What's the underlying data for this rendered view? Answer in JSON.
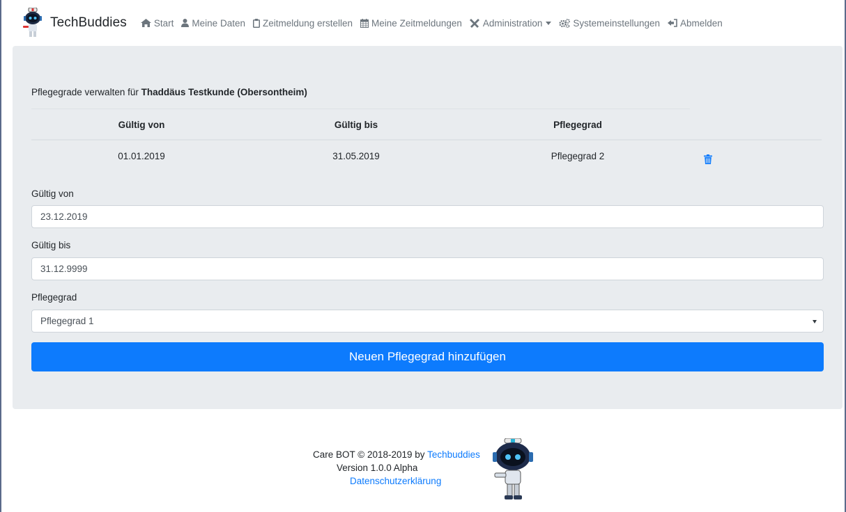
{
  "brand": {
    "name": "TechBuddies"
  },
  "nav": {
    "items": [
      {
        "label": "Start",
        "icon": "home-icon"
      },
      {
        "label": "Meine Daten",
        "icon": "user-icon"
      },
      {
        "label": "Zeitmeldung erstellen",
        "icon": "clipboard-icon"
      },
      {
        "label": "Meine Zeitmeldungen",
        "icon": "calendar-icon"
      },
      {
        "label": "Administration",
        "icon": "tools-icon",
        "dropdown": true
      },
      {
        "label": "Systemeinstellungen",
        "icon": "gears-icon"
      },
      {
        "label": "Abmelden",
        "icon": "sign-out-icon"
      }
    ]
  },
  "main": {
    "heading_prefix": "Pflegegrade verwalten für",
    "heading_name": "Thaddäus Testkunde (Obersontheim)",
    "table": {
      "headers": [
        "Gültig von",
        "Gültig bis",
        "Pflegegrad"
      ],
      "rows": [
        {
          "from": "01.01.2019",
          "to": "31.05.2019",
          "grade": "Pflegegrad 2",
          "action_icon": "trash-icon"
        }
      ]
    },
    "form": {
      "from_label": "Gültig von",
      "from_value": "23.12.2019",
      "to_label": "Gültig bis",
      "to_value": "31.12.9999",
      "grade_label": "Pflegegrad",
      "grade_selected": "Pflegegrad 1",
      "submit_label": "Neuen Pflegegrad hinzufügen"
    }
  },
  "footer": {
    "copyright": "Care BOT © 2018-2019 by",
    "company_link": "Techbuddies",
    "version": "Version 1.0.0 Alpha",
    "privacy_link": "Datenschutzerklärung"
  },
  "colors": {
    "primary": "#0d7bfd",
    "jumbotron_bg": "#e9ecef",
    "nav_text": "#6c757d"
  }
}
